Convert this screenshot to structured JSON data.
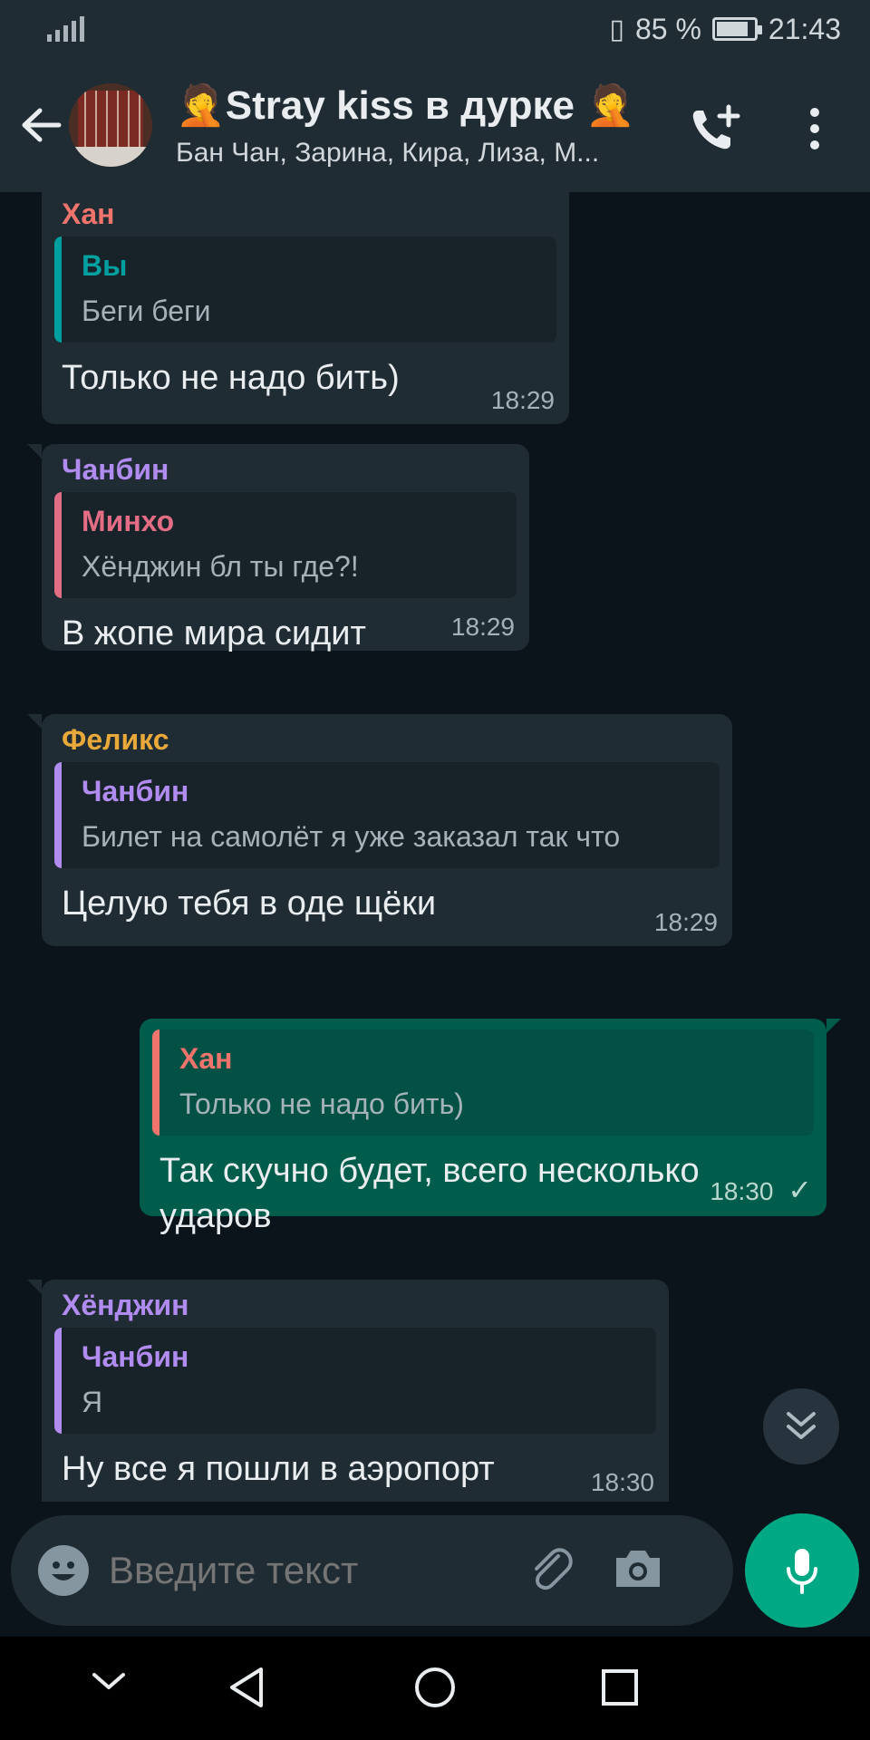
{
  "status_bar": {
    "battery": "85 %",
    "battery_level": 0.85,
    "time": "21:43"
  },
  "header": {
    "title": "🤦Stray kiss в дурке 🤦",
    "members": "Бан Чан, Зарина, Кира, Лиза, М..."
  },
  "messages": [
    {
      "sender": "Хан",
      "sender_color": "#f0746c",
      "quote_author": "Вы",
      "quote_color": "#00a0a0",
      "quote_text": "Беги беги",
      "text": "Только не надо бить)",
      "time": "18:29"
    },
    {
      "sender": "Чанбин",
      "sender_color": "#b18cf0",
      "quote_author": "Минхо",
      "quote_color": "#e26d85",
      "quote_text": "Хёнджин бл ты где?!",
      "text": "В жопе мира сидит",
      "time": "18:29"
    },
    {
      "sender": "Феликс",
      "sender_color": "#e8a93a",
      "quote_author": "Чанбин",
      "quote_color": "#b18cf0",
      "quote_text": "Билет на самолёт я уже заказал так что",
      "text": "Целую тебя в оде щёки",
      "time": "18:29"
    },
    {
      "outgoing": true,
      "quote_author": "Хан",
      "quote_color": "#f0746c",
      "quote_text": "Только не надо бить)",
      "text": "Так скучно будет, всего несколько ударов",
      "time": "18:30",
      "status": "✓"
    },
    {
      "sender": "Хёнджин",
      "sender_color": "#b18cf0",
      "quote_author": "Чанбин",
      "quote_color": "#b18cf0",
      "quote_text": "Я",
      "text": "Ну все я пошли в аэропорт",
      "time": "18:30"
    }
  ],
  "composer": {
    "placeholder": "Введите текст"
  },
  "colors": {
    "accent": "#00a884",
    "outgoing_bubble": "#005c4b",
    "incoming_bubble": "#202c33",
    "background": "#0b141a"
  }
}
